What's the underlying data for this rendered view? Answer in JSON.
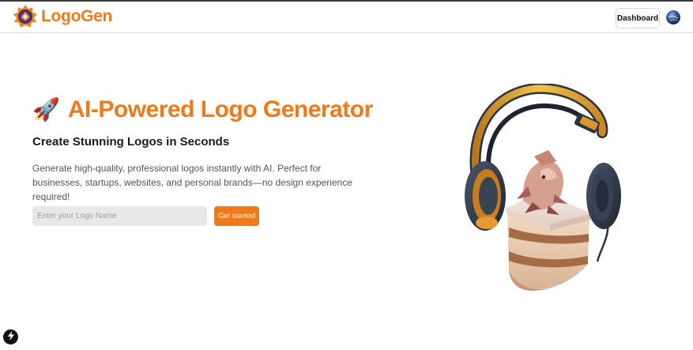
{
  "app": {
    "brand_name": "LogoGen",
    "logo_icon": "logogen-emblem-icon",
    "accent_color": "#f07a1a"
  },
  "header": {
    "dashboard_label": "Dashboard",
    "avatar_icon": "user-avatar-globe"
  },
  "hero": {
    "emoji": "🚀",
    "title": "AI-Powered Logo Generator",
    "subtitle": "Create Stunning Logos in Seconds",
    "description": "Generate high-quality, professional logos instantly with AI. Perfect for businesses, startups, websites, and personal brands—no design experience required!",
    "input_placeholder": "Enter your Logo Name",
    "input_value": "",
    "cta_label": "Get started",
    "illustration": "cake-slice-with-headphones-illustration"
  },
  "floating": {
    "icon": "lightning-bolt-icon"
  }
}
